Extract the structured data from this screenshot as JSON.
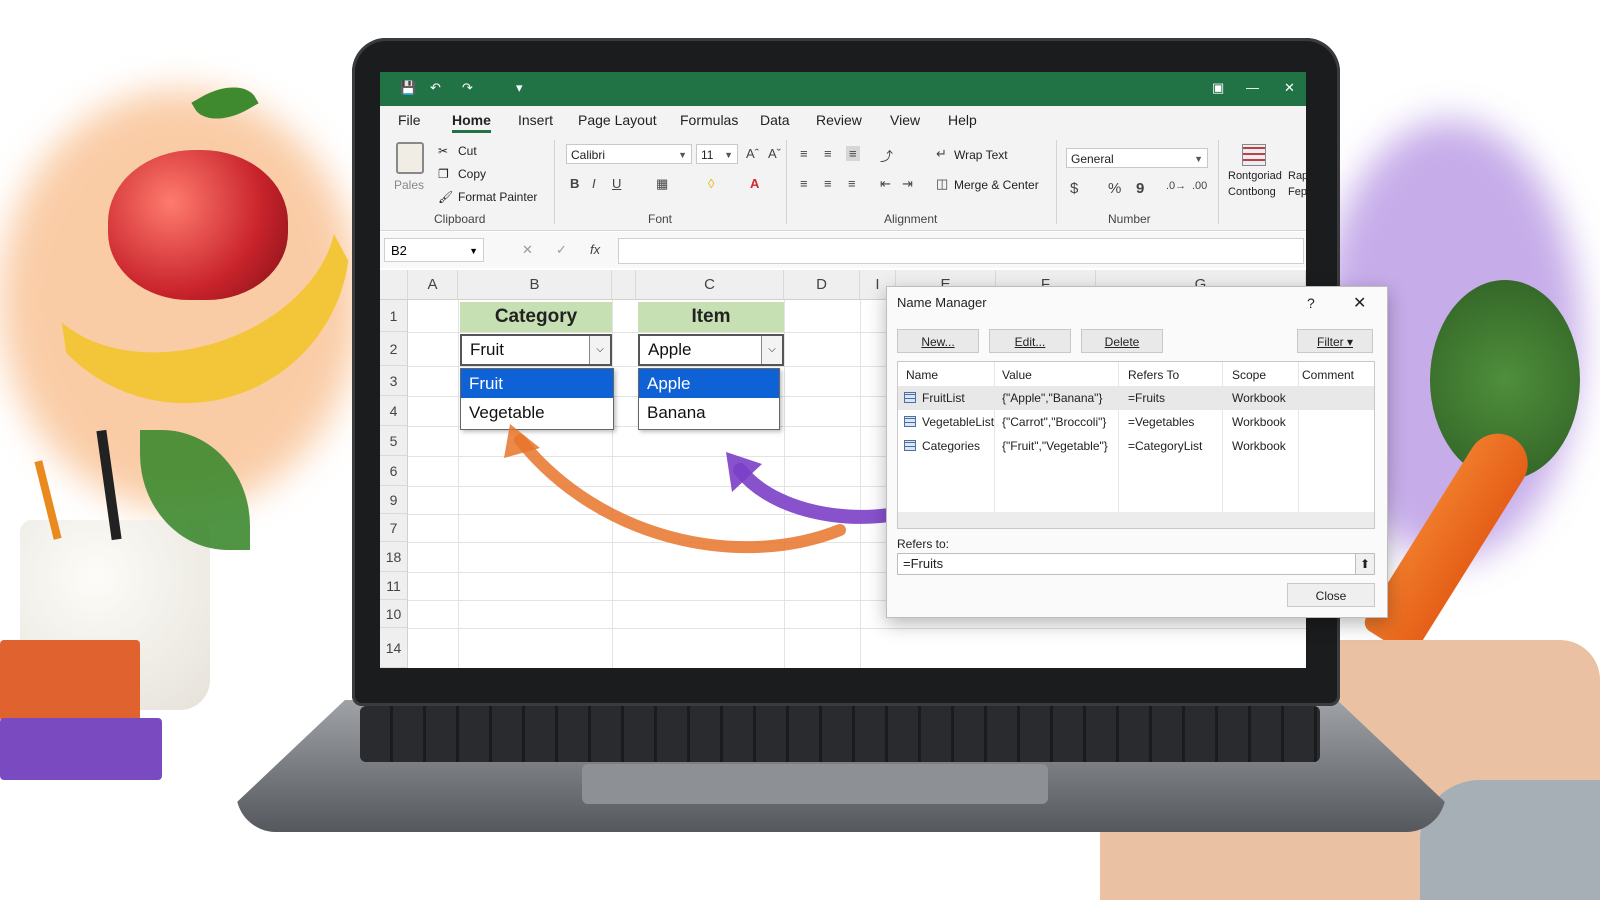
{
  "window": {
    "tab_names": [
      "File",
      "Home",
      "Insert",
      "Page Layout",
      "Formulas",
      "Data",
      "Review",
      "View",
      "Help"
    ]
  },
  "ribbon": {
    "clipboard": {
      "paste": "Pales",
      "cut": "Cut",
      "copy": "Copy",
      "format_painter": "Format Painter",
      "group": "Clipboard"
    },
    "font": {
      "family": "Calibri",
      "size": "11",
      "bold": "B",
      "italic": "I",
      "underline": "U",
      "group": "Font"
    },
    "alignment": {
      "wrap": "Wrap Text",
      "merge": "Merge & Center",
      "group": "Alignment"
    },
    "number": {
      "format": "General",
      "currency": "$",
      "percent": "%",
      "comma": "9",
      "group": "Number"
    },
    "styles": {
      "conditional": "Rontgoriad Contbong",
      "cut_label": "Rap Fep"
    }
  },
  "formula_bar": {
    "name_box": "B2",
    "fx": "fx"
  },
  "grid": {
    "columns": [
      "A",
      "B",
      "C",
      "D",
      "I",
      "E",
      "F",
      "G"
    ],
    "rows": [
      "1",
      "2",
      "3",
      "4",
      "5",
      "6",
      "9",
      "7",
      "18",
      "11",
      "10",
      "14"
    ],
    "b1": "Category",
    "c1": "Item",
    "b2": "Fruit",
    "c2": "Apple",
    "category_options": [
      "Fruit",
      "Vegetable"
    ],
    "item_options": [
      "Apple",
      "Banana"
    ]
  },
  "dialog": {
    "title": "Name Manager",
    "help": "?",
    "buttons": {
      "new": "New...",
      "edit": "Edit...",
      "delete": "Delete",
      "filter": "Filter ▾",
      "close": "Close"
    },
    "headers": [
      "Name",
      "Value",
      "Refers To",
      "Scope",
      "Comment"
    ],
    "rows": [
      {
        "name": "FruitList",
        "value": "{\"Apple\",\"Banana\"}",
        "refers": "=Fruits",
        "scope": "Workbook"
      },
      {
        "name": "VegetableList",
        "value": "{\"Carrot\",\"Broccoli\"}",
        "refers": "=Vegetables",
        "scope": "Workbook"
      },
      {
        "name": "Categories",
        "value": "{\"Fruit\",\"Vegetable\"}",
        "refers": "=CategoryList",
        "scope": "Workbook"
      }
    ],
    "refers_to_label": "Refers to:",
    "refers_to_value": "=Fruits"
  },
  "colors": {
    "excel_green": "#217346",
    "header_fill": "#c6e0b4",
    "selection": "#0f62d6",
    "arrow_orange": "#e8742a",
    "arrow_purple": "#7b3fc8"
  }
}
